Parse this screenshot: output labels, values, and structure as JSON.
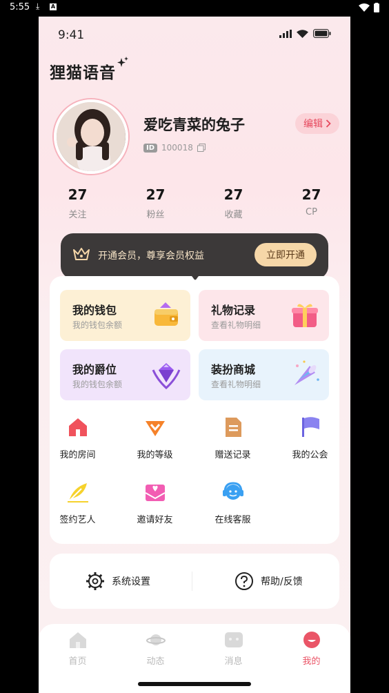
{
  "os": {
    "time": "5:55"
  },
  "status": {
    "time": "9:41"
  },
  "brand": {
    "name": "狸猫语音"
  },
  "profile": {
    "nickname": "爱吃青菜的兔子",
    "id_badge": "ID",
    "id_value": "100018",
    "edit_label": "编辑"
  },
  "stats": [
    {
      "value": "27",
      "label": "关注"
    },
    {
      "value": "27",
      "label": "粉丝"
    },
    {
      "value": "27",
      "label": "收藏"
    },
    {
      "value": "27",
      "label": "CP"
    }
  ],
  "vip": {
    "text": "开通会员，尊享会员权益",
    "button": "立即开通"
  },
  "cards": [
    {
      "title": "我的钱包",
      "subtitle": "我的钱包余额",
      "bg": "#fdf0d5",
      "icon": "wallet-icon"
    },
    {
      "title": "礼物记录",
      "subtitle": "查看礼物明细",
      "bg": "#fde6ea",
      "icon": "gift-box-icon"
    },
    {
      "title": "我的爵位",
      "subtitle": "我的钱包余额",
      "bg": "#f1e4fb",
      "icon": "gem-crest-icon"
    },
    {
      "title": "装扮商城",
      "subtitle": "查看礼物明细",
      "bg": "#e8f3fc",
      "icon": "party-horn-icon"
    }
  ],
  "grid": [
    {
      "label": "我的房间",
      "icon": "house-icon"
    },
    {
      "label": "我的等级",
      "icon": "level-icon"
    },
    {
      "label": "赠送记录",
      "icon": "document-icon"
    },
    {
      "label": "我的公会",
      "icon": "flag-icon"
    },
    {
      "label": "签约艺人",
      "icon": "feather-icon"
    },
    {
      "label": "邀请好友",
      "icon": "invite-envelope-icon"
    },
    {
      "label": "在线客服",
      "icon": "headset-icon"
    }
  ],
  "settings": [
    {
      "label": "系统设置",
      "icon": "gear-icon"
    },
    {
      "label": "帮助/反馈",
      "icon": "help-icon"
    }
  ],
  "tabs": [
    {
      "label": "首页",
      "active": false,
      "icon": "home-tab-icon"
    },
    {
      "label": "动态",
      "active": false,
      "icon": "planet-tab-icon"
    },
    {
      "label": "消息",
      "active": false,
      "icon": "message-tab-icon"
    },
    {
      "label": "我的",
      "active": true,
      "icon": "me-tab-icon"
    }
  ],
  "colors": {
    "accent": "#ea5567",
    "vip_bg": "#3c3939",
    "vip_gold": "#f6d7a8"
  }
}
